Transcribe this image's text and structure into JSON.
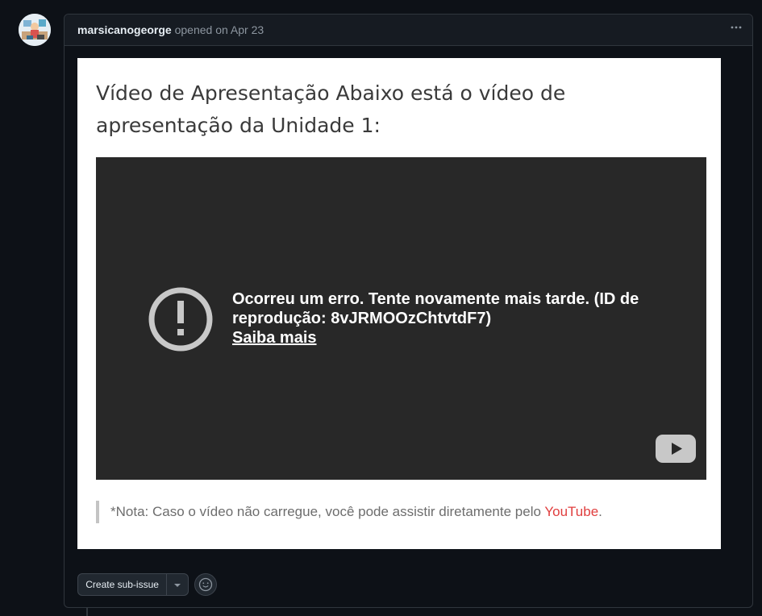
{
  "comment": {
    "author": "marsicanogeorge",
    "meta": "opened on Apr 23",
    "menu_icon": "kebab-horizontal-icon"
  },
  "card": {
    "title": "Vídeo de Apresentação Abaixo está o vídeo de apresentação da Unidade 1:",
    "video": {
      "error_message": "Ocorreu um erro. Tente novamente mais tarde. (ID de reprodução: 8vJRMOOzChtvtdF7)",
      "learn_more": "Saiba mais",
      "error_icon": "exclamation-circle-icon",
      "play_icon": "youtube-play-icon"
    },
    "note_text": "*Nota: Caso o vídeo não carregue, você pode assistir diretamente pelo ",
    "note_link": "YouTube",
    "note_end": "."
  },
  "actions": {
    "create_sub_issue": "Create sub-issue",
    "caret_icon": "triangle-down-icon",
    "reaction_icon": "smiley-icon"
  },
  "colors": {
    "background": "#0d1117",
    "header": "#161b22",
    "border": "#30363d",
    "link_red": "#e03e3e",
    "video_bg": "#282828"
  }
}
